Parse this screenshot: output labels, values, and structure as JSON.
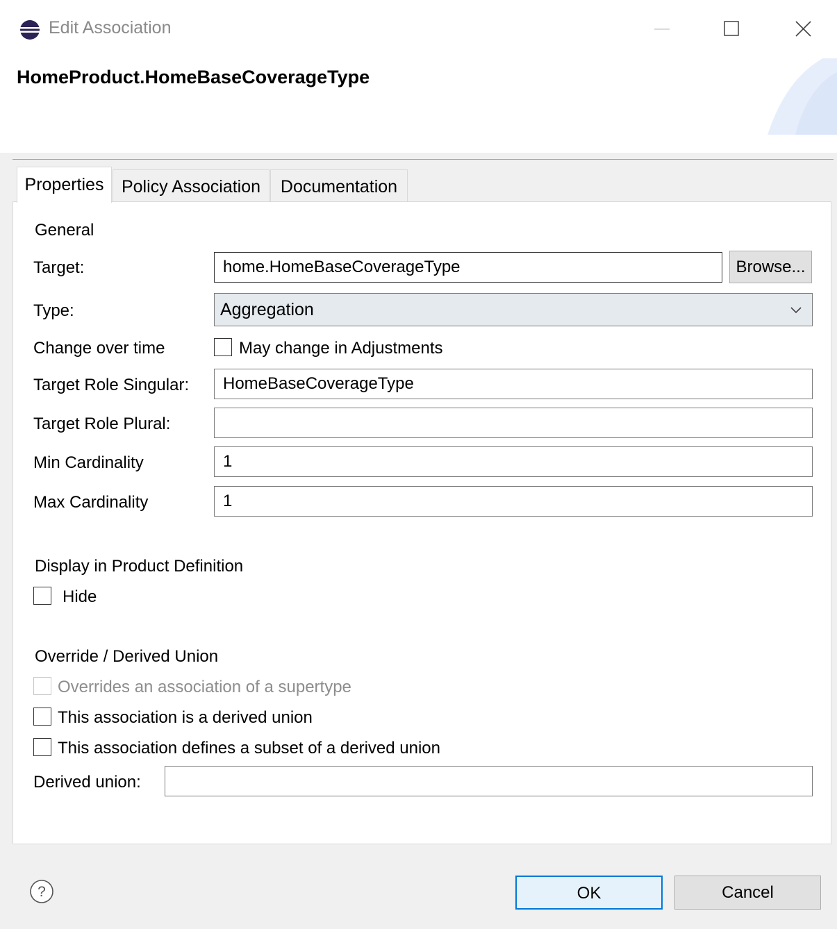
{
  "window": {
    "title": "Edit Association",
    "icon": "eclipse-icon",
    "controls": [
      "minimize-icon",
      "maximize-icon",
      "close-icon"
    ]
  },
  "header": {
    "title": "HomeProduct.HomeBaseCoverageType"
  },
  "tabs": [
    {
      "label": "Properties",
      "active": true
    },
    {
      "label": "Policy Association",
      "active": false
    },
    {
      "label": "Documentation",
      "active": false
    }
  ],
  "general": {
    "section_label": "General",
    "target_label": "Target:",
    "target_value": "home.HomeBaseCoverageType",
    "browse_label": "Browse...",
    "type_label": "Type:",
    "type_value": "Aggregation",
    "change_label": "Change over time",
    "change_checkbox_label": "May change in Adjustments",
    "change_checked": false,
    "role_singular_label": "Target Role Singular:",
    "role_singular_value": "HomeBaseCoverageType",
    "role_plural_label": "Target Role Plural:",
    "role_plural_value": "",
    "min_card_label": "Min Cardinality",
    "min_card_value": "1",
    "max_card_label": "Max Cardinality",
    "max_card_value": "1"
  },
  "display": {
    "section_label": "Display in Product Definition",
    "hide_label": "Hide",
    "hide_checked": false
  },
  "override": {
    "section_label": "Override / Derived Union",
    "overrides_label": "Overrides an association of a supertype",
    "overrides_enabled": false,
    "derived_union_label": "This association is a derived union",
    "subset_label": "This association defines a subset of a derived union",
    "derived_union_field_label": "Derived union:",
    "derived_union_value": ""
  },
  "footer": {
    "help_icon": "help-icon",
    "ok_label": "OK",
    "cancel_label": "Cancel"
  },
  "colors": {
    "accent": "#0078d7",
    "combo_bg": "#e5eaef",
    "disabled_text": "#8d8d8d"
  }
}
